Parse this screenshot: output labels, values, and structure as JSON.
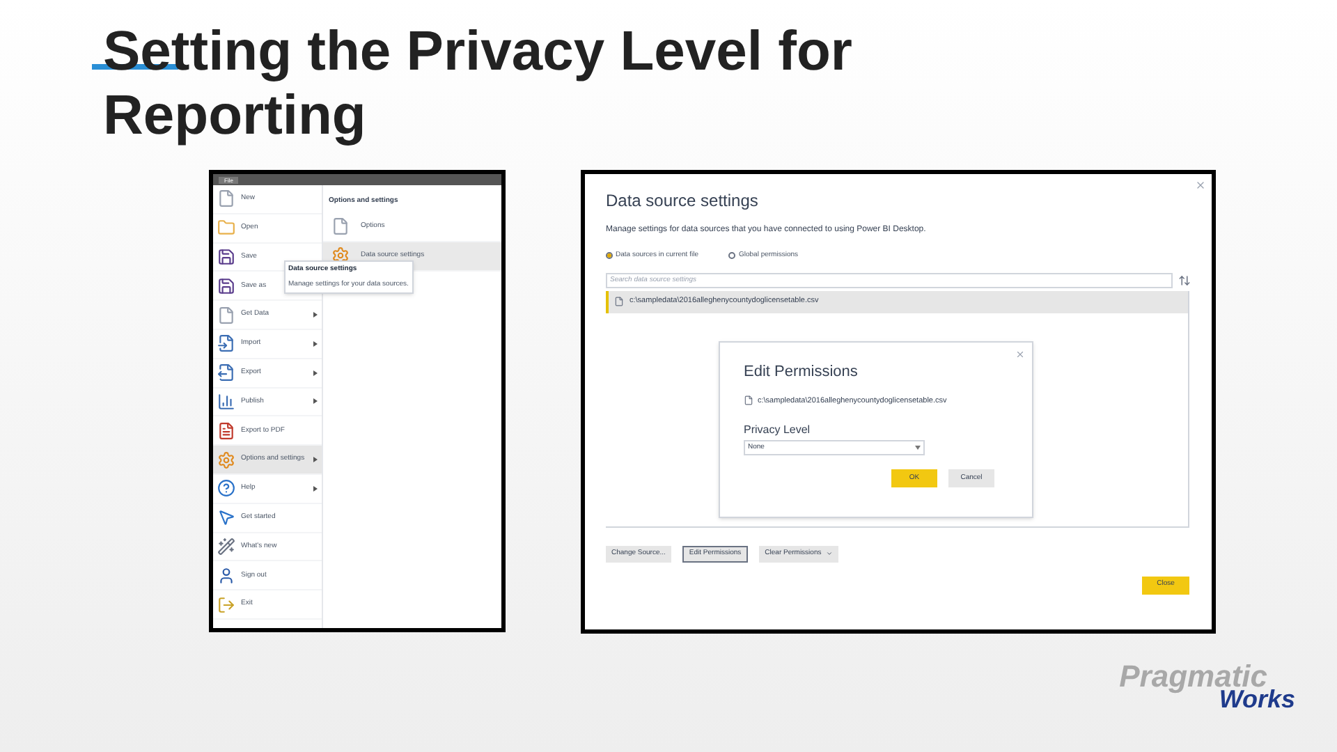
{
  "slide": {
    "title": "Setting the Privacy Level for Reporting",
    "logo": {
      "line_1": "Pragmatic",
      "line_2": "Works"
    }
  },
  "file_menu": {
    "tab": "File",
    "items": [
      {
        "label": "New",
        "kind": "file",
        "submenu": false,
        "selected": false
      },
      {
        "label": "Open",
        "kind": "folder",
        "submenu": false,
        "selected": false
      },
      {
        "label": "Save",
        "kind": "save",
        "submenu": false,
        "selected": false
      },
      {
        "label": "Save as",
        "kind": "save",
        "submenu": false,
        "selected": false
      },
      {
        "label": "Get Data",
        "kind": "file",
        "submenu": true,
        "selected": false
      },
      {
        "label": "Import",
        "kind": "import",
        "submenu": true,
        "selected": false
      },
      {
        "label": "Export",
        "kind": "export",
        "submenu": true,
        "selected": false
      },
      {
        "label": "Publish",
        "kind": "chart",
        "submenu": true,
        "selected": false
      },
      {
        "label": "Export to PDF",
        "kind": "pdf",
        "submenu": false,
        "selected": false
      },
      {
        "label": "Options and settings",
        "kind": "gear",
        "submenu": true,
        "selected": true
      },
      {
        "label": "Help",
        "kind": "help",
        "submenu": true,
        "selected": false
      },
      {
        "label": "Get started",
        "kind": "pointer",
        "submenu": false,
        "selected": false
      },
      {
        "label": "What's new",
        "kind": "wand",
        "submenu": false,
        "selected": false
      },
      {
        "label": "Sign out",
        "kind": "user",
        "submenu": false,
        "selected": false
      },
      {
        "label": "Exit",
        "kind": "exit",
        "submenu": false,
        "selected": false
      }
    ],
    "panel": {
      "heading": "Options and settings",
      "items": [
        {
          "label": "Options",
          "kind": "file",
          "selected": false
        },
        {
          "label": "Data source settings",
          "kind": "gear",
          "selected": true
        }
      ]
    },
    "tooltip": {
      "title": "Data source settings",
      "text": "Manage settings for your data sources."
    }
  },
  "dialog": {
    "title": "Data source settings",
    "description": "Manage settings for data sources that you have connected to using Power BI Desktop.",
    "scopes": [
      {
        "label": "Data sources in current file",
        "selected": true
      },
      {
        "label": "Global permissions",
        "selected": false
      }
    ],
    "search": {
      "placeholder": "Search data source settings"
    },
    "sources": [
      {
        "path": "c:\\sampledata\\2016alleghenycountydoglicensetable.csv",
        "selected": true
      }
    ],
    "buttons": [
      {
        "label": "Change Source...",
        "selected": false,
        "dropdown": false
      },
      {
        "label": "Edit Permissions",
        "selected": true,
        "dropdown": false
      },
      {
        "label": "Clear Permissions",
        "selected": false,
        "dropdown": true
      }
    ],
    "close_button": "Close",
    "edit_permissions": {
      "title": "Edit Permissions",
      "path": "c:\\sampledata\\2016alleghenycountydoglicensetable.csv",
      "privacy_label": "Privacy Level",
      "privacy_value": "None",
      "ok": "OK",
      "cancel": "Cancel"
    }
  }
}
